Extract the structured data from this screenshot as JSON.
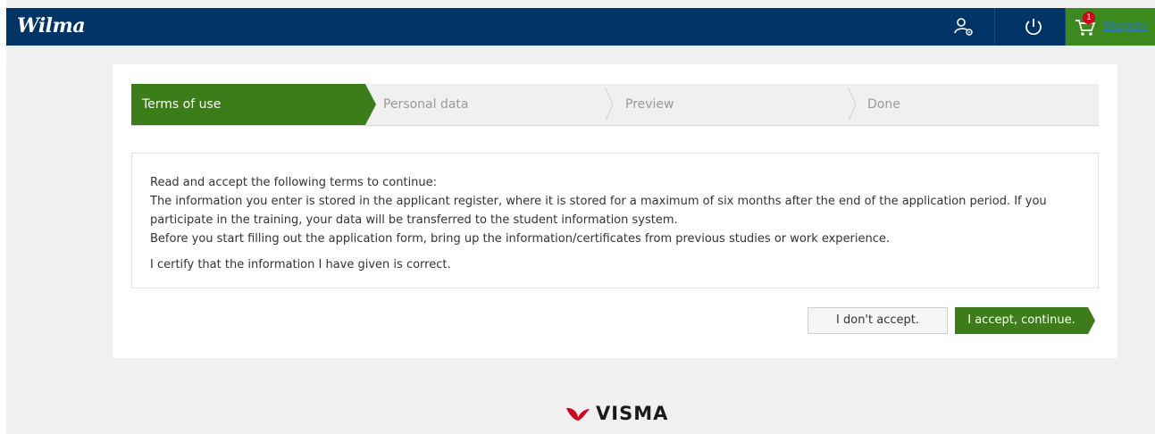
{
  "app": {
    "logo_text": "Wilma"
  },
  "header": {
    "icons": [
      "user-settings-icon",
      "power-icon",
      "shopping-cart-icon"
    ],
    "cart_count": "1",
    "cart_link": "Shoppin"
  },
  "steps": [
    {
      "label": "Terms of use",
      "active": true
    },
    {
      "label": "Personal data",
      "active": false
    },
    {
      "label": "Preview",
      "active": false
    },
    {
      "label": "Done",
      "active": false
    }
  ],
  "terms": {
    "line1": "Read and accept the following terms to continue:",
    "line2": "The information you enter is stored in the applicant register, where it is stored for a maximum of six months after the end of the application period. If you",
    "line3": "participate in the training, your data will be transferred to the student information system.",
    "line4": "Before you start filling out the application form, bring up the information/certificates from previous studies or work experience.",
    "line5": "I certify that the information I have given is correct."
  },
  "buttons": {
    "decline": "I don't accept.",
    "accept": "I accept, continue."
  },
  "footer": {
    "brand": "VISMA"
  },
  "colors": {
    "topbar": "#003366",
    "accent_green": "#3d7d19",
    "cart_green": "#3c8a1e"
  }
}
